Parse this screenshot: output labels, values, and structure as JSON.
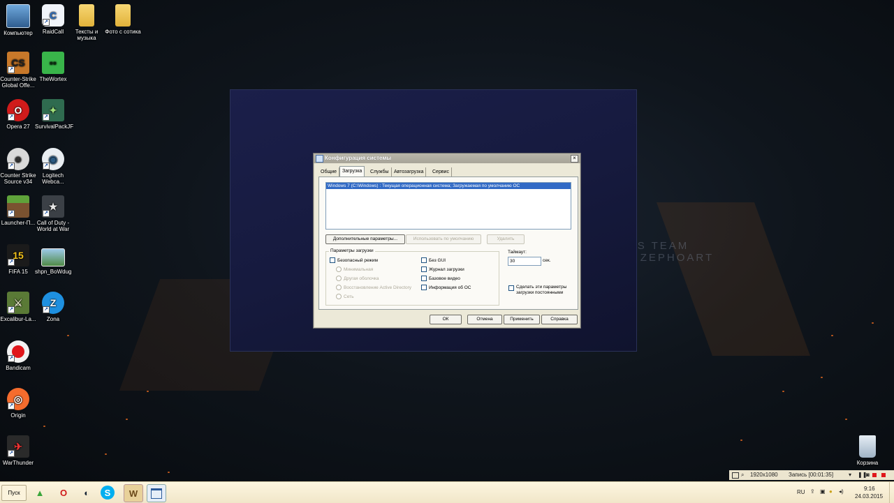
{
  "desktop_icons": [
    {
      "label": "Компьютер",
      "icon": "computer-icon"
    },
    {
      "label": "RaidCall",
      "icon": "raidcall-icon"
    },
    {
      "label": "Тексты и музыка",
      "icon": "folder-icon"
    },
    {
      "label": "Фото с сотика",
      "icon": "folder-icon"
    },
    {
      "label": "Counter-Strike Global Offe...",
      "icon": "csgo-icon"
    },
    {
      "label": "TheWortex",
      "icon": "creeper-icon"
    },
    {
      "label": "Opera 27",
      "icon": "opera-icon"
    },
    {
      "label": "SurvivalPackJF",
      "icon": "survival-icon"
    },
    {
      "label": "Counter Strike Source v34",
      "icon": "css-icon"
    },
    {
      "label": "Logitech Webca...",
      "icon": "webcam-icon"
    },
    {
      "label": "Launcher-П...",
      "icon": "minecraft-icon"
    },
    {
      "label": "Call of Duty - World at War",
      "icon": "cod-icon"
    },
    {
      "label": "FIFA 15",
      "icon": "fifa-icon"
    },
    {
      "label": "shpn_BoWdug",
      "icon": "image-icon"
    },
    {
      "label": "Excalibur-La...",
      "icon": "excalibur-icon"
    },
    {
      "label": "Zona",
      "icon": "zona-icon"
    },
    {
      "label": "Bandicam",
      "icon": "bandicam-icon"
    },
    {
      "label": "Origin",
      "icon": "origin-icon"
    },
    {
      "label": "WarThunder",
      "icon": "warthunder-icon"
    },
    {
      "label": "Корзина",
      "icon": "recycle-bin-icon"
    }
  ],
  "wallpaper": {
    "text_line1": "OVE THIS TEAM",
    "text_line2": "SIGN BY ZEPHOART"
  },
  "dialog": {
    "title": "Конфигурация системы",
    "close_glyph": "×",
    "tabs": [
      "Общие",
      "Загрузка",
      "Службы",
      "Автозагрузка",
      "Сервис"
    ],
    "active_tab": "Загрузка",
    "os_entry": "Windows 7 (C:\\Windows) : Текущая операционная система; Загружаемая по умолчанию ОС",
    "btn_advanced": "Дополнительные параметры...",
    "btn_default": "Использовать по умолчанию",
    "btn_delete": "Удалить",
    "boot_options_legend": "Параметры загрузки",
    "safe_mode": "Безопасный режим",
    "radio_minimal": "Минимальная",
    "radio_alt_shell": "Другая оболочка",
    "radio_ad_repair": "Восстановление Active Directory",
    "radio_network": "Сеть",
    "no_gui": "Без GUI",
    "boot_log": "Журнал загрузки",
    "base_video": "Базовое видео",
    "os_info": "Информация об ОС",
    "timeout_label": "Таймаут:",
    "timeout_value": "30",
    "timeout_unit": "сек.",
    "make_permanent": "Сделать эти параметры загрузки постоянными",
    "btn_ok": "ОК",
    "btn_cancel": "Отмена",
    "btn_apply": "Применить",
    "btn_help": "Справка"
  },
  "taskbar": {
    "start_label": "Пуск",
    "apps": [
      "androidapp-icon",
      "opera-icon",
      "steam-icon",
      "skype-icon",
      "wow-icon",
      "window-icon"
    ],
    "language": "RU",
    "time": "9:16",
    "date": "24.03.2015"
  },
  "recording": {
    "resolution": "1920x1080",
    "status": "Запись [00:01:35]"
  }
}
